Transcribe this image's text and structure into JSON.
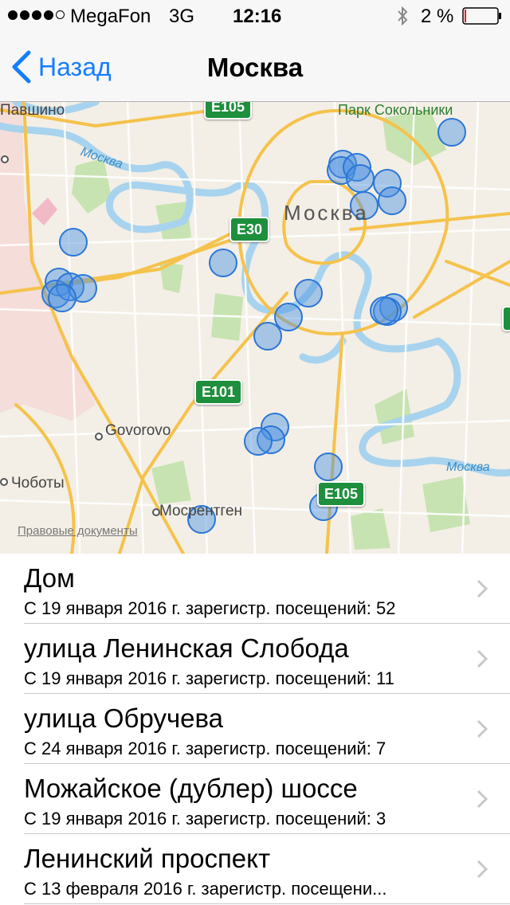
{
  "status": {
    "carrier": "MegaFon",
    "network": "3G",
    "time": "12:16",
    "battery": "2 %",
    "signal_bars": 4,
    "bluetooth_icon": "bluetooth-icon"
  },
  "nav": {
    "back_label": "Назад",
    "title": "Москва"
  },
  "map": {
    "city_label": "Москва",
    "labels": {
      "pavshino": "Павшино",
      "park": "Парк Сокольники",
      "govorovo": "Govorovo",
      "chobotoy": "Чоботы",
      "mosrentgen": "Мосрентген",
      "river1": "Москва",
      "river2": "Москва"
    },
    "shields": {
      "e105_top": "E105",
      "e30": "E30",
      "e101": "E101",
      "e105": "E105"
    },
    "legal": "Правовые документы",
    "colors": {
      "visit_dot": "#4a90e2",
      "water": "#a8d3ef",
      "park": "#c7e3b1",
      "road": "#f5c24c"
    }
  },
  "places": [
    {
      "name": "Дом",
      "detail": "С 19 января 2016 г. зарегистр. посещений: 52"
    },
    {
      "name": "улица Ленинская Слобода",
      "detail": "С 19 января 2016 г. зарегистр. посещений: 11"
    },
    {
      "name": "улица Обручева",
      "detail": "С 24 января 2016 г. зарегистр. посещений: 7"
    },
    {
      "name": "Можайское (дублер) шоссе",
      "detail": "С 19 января 2016 г. зарегистр. посещений: 3"
    },
    {
      "name": "Ленинский проспект",
      "detail": "С 13 февраля 2016 г. зарегистр. посещени..."
    }
  ]
}
